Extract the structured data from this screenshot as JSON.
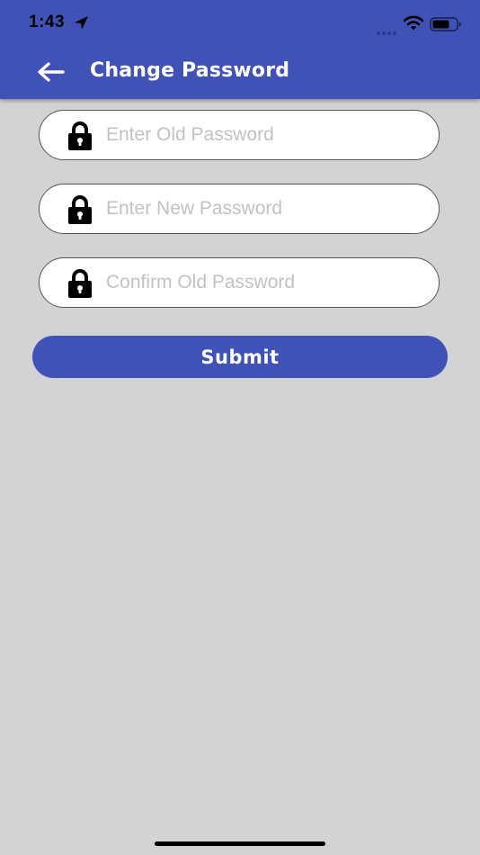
{
  "status_bar": {
    "time": "1:43",
    "icons": [
      "location-arrow-icon",
      "cellular-signal-icon",
      "wifi-icon",
      "battery-icon"
    ]
  },
  "header": {
    "title": "Change Password",
    "back_icon": "arrow-left-icon"
  },
  "form": {
    "old_password": {
      "placeholder": "Enter Old Password",
      "value": "",
      "icon": "lock-icon"
    },
    "new_password": {
      "placeholder": "Enter New Password",
      "value": "",
      "icon": "lock-icon"
    },
    "confirm_password": {
      "placeholder": "Confirm Old Password",
      "value": "",
      "icon": "lock-icon"
    },
    "submit_label": "Submit"
  },
  "colors": {
    "primary": "#4052b5",
    "background": "#d3d3d3",
    "field_background": "#ffffff",
    "placeholder": "#c2c2c6"
  }
}
